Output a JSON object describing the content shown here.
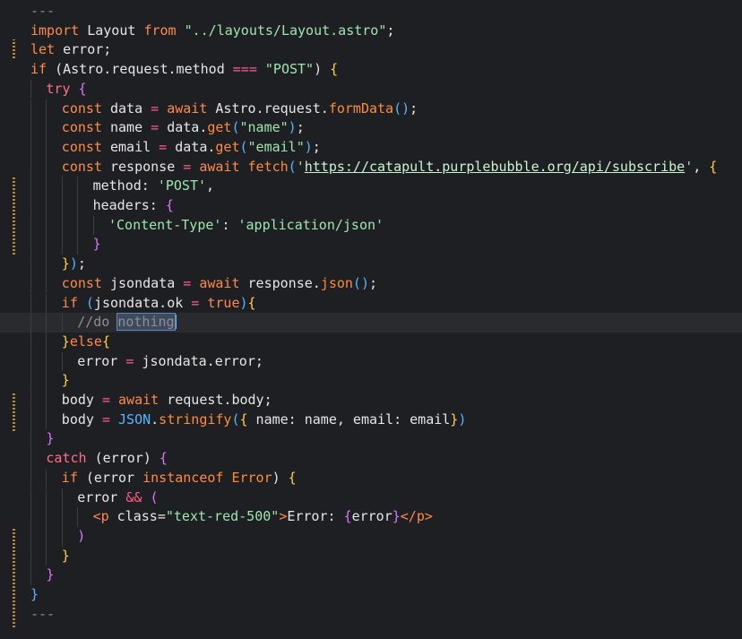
{
  "editor": {
    "lines": [
      {
        "indent": 0,
        "tokens": [
          [
            "tok-comment",
            "---"
          ]
        ]
      },
      {
        "indent": 0,
        "tokens": [
          [
            "tok-kw",
            "import"
          ],
          [
            "tok-plain",
            " Layout "
          ],
          [
            "tok-kw",
            "from"
          ],
          [
            "tok-plain",
            " "
          ],
          [
            "tok-str",
            "\"../layouts/Layout.astro\""
          ],
          [
            "tok-plain",
            ";"
          ]
        ]
      },
      {
        "indent": 0,
        "tokens": [
          [
            "tok-kw",
            "let"
          ],
          [
            "tok-plain",
            " error;"
          ]
        ]
      },
      {
        "indent": 0,
        "tokens": [
          [
            "tok-kw",
            "if"
          ],
          [
            "tok-plain",
            " (Astro.request.method "
          ],
          [
            "tok-op",
            "==="
          ],
          [
            "tok-plain",
            " "
          ],
          [
            "tok-str",
            "\"POST\""
          ],
          [
            "tok-plain",
            ") "
          ],
          [
            "tok-brace-a",
            "{"
          ]
        ]
      },
      {
        "indent": 1,
        "tokens": [
          [
            "tok-ctrl",
            "try"
          ],
          [
            "tok-plain",
            " "
          ],
          [
            "tok-brace-b",
            "{"
          ]
        ]
      },
      {
        "indent": 2,
        "tokens": [
          [
            "tok-kw",
            "const"
          ],
          [
            "tok-plain",
            " data "
          ],
          [
            "tok-op",
            "="
          ],
          [
            "tok-plain",
            " "
          ],
          [
            "tok-kw",
            "await"
          ],
          [
            "tok-plain",
            " Astro.request."
          ],
          [
            "tok-fn",
            "formData"
          ],
          [
            "tok-brace-c",
            "()"
          ],
          [
            "tok-plain",
            ";"
          ]
        ]
      },
      {
        "indent": 2,
        "tokens": [
          [
            "tok-kw",
            "const"
          ],
          [
            "tok-plain",
            " name "
          ],
          [
            "tok-op",
            "="
          ],
          [
            "tok-plain",
            " data."
          ],
          [
            "tok-fn",
            "get"
          ],
          [
            "tok-brace-c",
            "("
          ],
          [
            "tok-str",
            "\"name\""
          ],
          [
            "tok-brace-c",
            ")"
          ],
          [
            "tok-plain",
            ";"
          ]
        ]
      },
      {
        "indent": 2,
        "tokens": [
          [
            "tok-kw",
            "const"
          ],
          [
            "tok-plain",
            " email "
          ],
          [
            "tok-op",
            "="
          ],
          [
            "tok-plain",
            " data."
          ],
          [
            "tok-fn",
            "get"
          ],
          [
            "tok-brace-c",
            "("
          ],
          [
            "tok-str",
            "\"email\""
          ],
          [
            "tok-brace-c",
            ")"
          ],
          [
            "tok-plain",
            ";"
          ]
        ]
      },
      {
        "indent": 2,
        "tokens": [
          [
            "tok-kw",
            "const"
          ],
          [
            "tok-plain",
            " response "
          ],
          [
            "tok-op",
            "="
          ],
          [
            "tok-plain",
            " "
          ],
          [
            "tok-kw",
            "await"
          ],
          [
            "tok-plain",
            " "
          ],
          [
            "tok-fn",
            "fetch"
          ],
          [
            "tok-brace-c",
            "("
          ],
          [
            "tok-str",
            "'"
          ],
          [
            "tok-url",
            "https://catapult.purplebubble.org/api/subscribe"
          ],
          [
            "tok-str",
            "'"
          ],
          [
            "tok-plain",
            ", "
          ],
          [
            "tok-brace-a",
            "{"
          ]
        ]
      },
      {
        "indent": 4,
        "tokens": [
          [
            "tok-plain",
            "method: "
          ],
          [
            "tok-str",
            "'POST'"
          ],
          [
            "tok-plain",
            ","
          ]
        ]
      },
      {
        "indent": 4,
        "tokens": [
          [
            "tok-plain",
            "headers: "
          ],
          [
            "tok-brace-b",
            "{"
          ]
        ]
      },
      {
        "indent": 5,
        "tokens": [
          [
            "tok-str",
            "'Content-Type'"
          ],
          [
            "tok-plain",
            ": "
          ],
          [
            "tok-str",
            "'application/json'"
          ]
        ]
      },
      {
        "indent": 4,
        "tokens": [
          [
            "tok-brace-b",
            "}"
          ]
        ]
      },
      {
        "indent": 2,
        "tokens": [
          [
            "tok-brace-a",
            "}"
          ],
          [
            "tok-brace-c",
            ")"
          ],
          [
            "tok-plain",
            ";"
          ]
        ]
      },
      {
        "indent": 2,
        "tokens": [
          [
            "tok-kw",
            "const"
          ],
          [
            "tok-plain",
            " jsondata "
          ],
          [
            "tok-op",
            "="
          ],
          [
            "tok-plain",
            " "
          ],
          [
            "tok-kw",
            "await"
          ],
          [
            "tok-plain",
            " response."
          ],
          [
            "tok-fn",
            "json"
          ],
          [
            "tok-brace-c",
            "()"
          ],
          [
            "tok-plain",
            ";"
          ]
        ]
      },
      {
        "indent": 2,
        "tokens": [
          [
            "tok-kw",
            "if"
          ],
          [
            "tok-plain",
            " "
          ],
          [
            "tok-brace-c",
            "("
          ],
          [
            "tok-plain",
            "jsondata.ok "
          ],
          [
            "tok-op",
            "="
          ],
          [
            "tok-plain",
            " "
          ],
          [
            "tok-kw",
            "true"
          ],
          [
            "tok-brace-c",
            ")"
          ],
          [
            "tok-brace-a",
            "{"
          ]
        ]
      },
      {
        "indent": 3,
        "current": true,
        "tokens": [
          [
            "tok-comment",
            "//do "
          ],
          [
            "tok-comment sel",
            "nothing"
          ],
          [
            "caret",
            ""
          ]
        ]
      },
      {
        "indent": 2,
        "tokens": [
          [
            "tok-brace-a",
            "}"
          ],
          [
            "tok-kw",
            "else"
          ],
          [
            "tok-brace-a",
            "{"
          ]
        ]
      },
      {
        "indent": 3,
        "tokens": [
          [
            "tok-plain",
            "error "
          ],
          [
            "tok-op",
            "="
          ],
          [
            "tok-plain",
            " jsondata.error;"
          ]
        ]
      },
      {
        "indent": 2,
        "tokens": [
          [
            "tok-brace-a",
            "}"
          ]
        ]
      },
      {
        "indent": 2,
        "tokens": [
          [
            "tok-plain",
            "body "
          ],
          [
            "tok-op",
            "="
          ],
          [
            "tok-plain",
            " "
          ],
          [
            "tok-kw",
            "await"
          ],
          [
            "tok-plain",
            " request.body;"
          ]
        ]
      },
      {
        "indent": 2,
        "tokens": [
          [
            "tok-plain",
            "body "
          ],
          [
            "tok-op",
            "="
          ],
          [
            "tok-plain",
            " "
          ],
          [
            "tok-brace-c",
            "JSON"
          ],
          [
            "tok-plain",
            "."
          ],
          [
            "tok-fn",
            "stringify"
          ],
          [
            "tok-brace-c",
            "("
          ],
          [
            "tok-brace-a",
            "{"
          ],
          [
            "tok-plain",
            " name: name, email: email"
          ],
          [
            "tok-brace-a",
            "}"
          ],
          [
            "tok-brace-c",
            ")"
          ]
        ]
      },
      {
        "indent": 1,
        "tokens": [
          [
            "tok-brace-b",
            "}"
          ]
        ]
      },
      {
        "indent": 1,
        "tokens": [
          [
            "tok-ctrl",
            "catch"
          ],
          [
            "tok-plain",
            " (error) "
          ],
          [
            "tok-brace-b",
            "{"
          ]
        ]
      },
      {
        "indent": 2,
        "tokens": [
          [
            "tok-kw",
            "if"
          ],
          [
            "tok-plain",
            " (error "
          ],
          [
            "tok-kw",
            "instanceof"
          ],
          [
            "tok-plain",
            " "
          ],
          [
            "tok-fn",
            "Error"
          ],
          [
            "tok-plain",
            ") "
          ],
          [
            "tok-brace-a",
            "{"
          ]
        ]
      },
      {
        "indent": 3,
        "tokens": [
          [
            "tok-plain",
            "error "
          ],
          [
            "tok-op",
            "&&"
          ],
          [
            "tok-plain",
            " "
          ],
          [
            "tok-brace-b",
            "("
          ]
        ]
      },
      {
        "indent": 4,
        "tokens": [
          [
            "tok-tag",
            "<p"
          ],
          [
            "tok-plain",
            " class="
          ],
          [
            "tok-str",
            "\"text-red-500\""
          ],
          [
            "tok-tag",
            ">"
          ],
          [
            "tok-plain",
            "Error: "
          ],
          [
            "tok-brace-b",
            "{"
          ],
          [
            "tok-plain",
            "error"
          ],
          [
            "tok-brace-b",
            "}"
          ],
          [
            "tok-tag",
            "</p>"
          ]
        ]
      },
      {
        "indent": 3,
        "tokens": [
          [
            "tok-brace-b",
            ")"
          ]
        ]
      },
      {
        "indent": 2,
        "tokens": [
          [
            "tok-brace-a",
            "}"
          ]
        ]
      },
      {
        "indent": 1,
        "tokens": [
          [
            "tok-brace-b",
            "}"
          ]
        ]
      },
      {
        "indent": 0,
        "tokens": [
          [
            "tok-brace-c",
            "}"
          ]
        ]
      },
      {
        "indent": 0,
        "tokens": [
          [
            "tok-comment",
            "---"
          ]
        ]
      }
    ]
  }
}
